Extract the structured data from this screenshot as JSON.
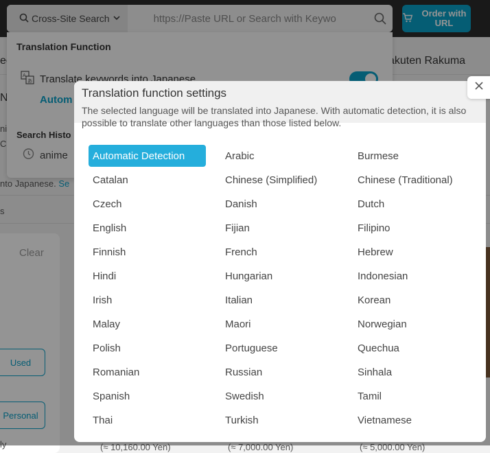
{
  "header": {
    "cross_site_label": "Cross-Site Search",
    "search_placeholder": "https://Paste URL or Search with Keywo",
    "order_button": "Order with URL",
    "accent": "#0aa0c8"
  },
  "background": {
    "tab_left_fragment": "ec",
    "tab_right": "akuten Rakuma",
    "nav_fragment": "N",
    "side_fragment_1": "ni",
    "side_fragment_2": "C",
    "notice_text": "nto Japanese.",
    "notice_link": "Se",
    "filter_fragment": "s",
    "clear_label": "Clear",
    "used_button": "Used",
    "personal_button": "Personal",
    "bottom_fragment": "ly",
    "prices": [
      "(≈ 10,160.00 Yen)",
      "(≈ 7,000.00 Yen)",
      "(≈ 5,000.00 Yen)"
    ]
  },
  "dropdown": {
    "title": "Translation Function",
    "translate_label": "Translate keywords into Japanese",
    "toggle_on": true,
    "auto_label": "Autom",
    "history_title": "Search Histo",
    "history_item": "anime"
  },
  "modal": {
    "title": "Translation function settings",
    "description": "The selected language will be translated into Japanese. With automatic detection, it is also possible to translate other languages than those listed below.",
    "selected": "Automatic Detection",
    "selected_color": "#25aedc",
    "languages": [
      "Automatic Detection",
      "Arabic",
      "Burmese",
      "Catalan",
      "Chinese (Simplified)",
      "Chinese (Traditional)",
      "Czech",
      "Danish",
      "Dutch",
      "English",
      "Fijian",
      "Filipino",
      "Finnish",
      "French",
      "Hebrew",
      "Hindi",
      "Hungarian",
      "Indonesian",
      "Irish",
      "Italian",
      "Korean",
      "Malay",
      "Maori",
      "Norwegian",
      "Polish",
      "Portuguese",
      "Quechua",
      "Romanian",
      "Russian",
      "Sinhala",
      "Spanish",
      "Swedish",
      "Tamil",
      "Thai",
      "Turkish",
      "Vietnamese"
    ]
  }
}
